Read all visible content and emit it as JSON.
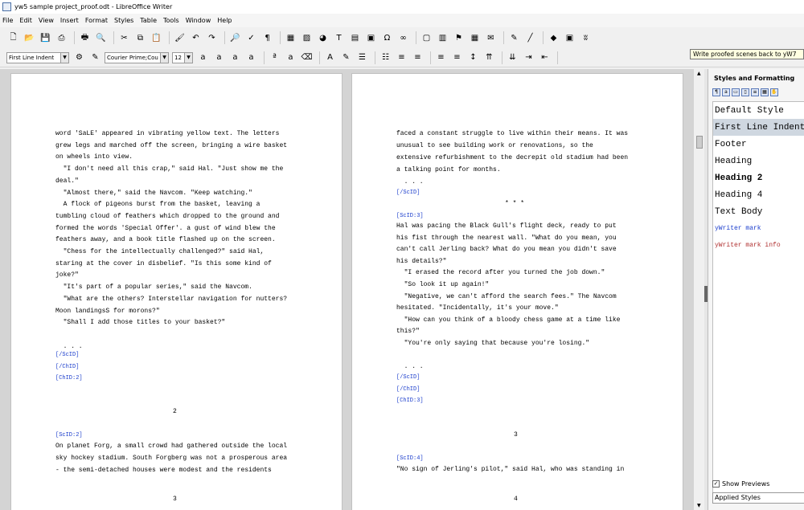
{
  "window": {
    "title": "yw5 sample project_proof.odt - LibreOffice Writer"
  },
  "menu": [
    "File",
    "Edit",
    "View",
    "Insert",
    "Format",
    "Styles",
    "Table",
    "Tools",
    "Window",
    "Help"
  ],
  "formatting": {
    "paragraph_style": "First Line Indent",
    "font_name": "Courier Prime;Cou",
    "font_size": "12"
  },
  "tooltip": "Write proofed scenes back to yW7",
  "toolbar1_icons": [
    "new-document-icon",
    "open-icon",
    "save-icon",
    "export-pdf-icon",
    "print-icon",
    "print-preview-icon",
    "cut-icon",
    "copy-icon",
    "paste-icon",
    "clone-formatting-icon",
    "undo-icon",
    "redo-icon",
    "find-replace-icon",
    "spelling-icon",
    "formatting-marks-icon",
    "insert-table-icon",
    "insert-image-icon",
    "insert-chart-icon",
    "insert-textbox-icon",
    "page-break-icon",
    "insert-field-icon",
    "special-character-icon",
    "hyperlink-icon",
    "footnote-icon",
    "endnote-icon",
    "bookmark-icon",
    "cross-reference-icon",
    "comment-icon",
    "track-changes-icon",
    "line-icon",
    "basic-shapes-icon",
    "draw-functions-icon",
    "yw-proof-icon"
  ],
  "toolbar2_icons": [
    "update-style-icon",
    "new-style-icon",
    "bold-icon",
    "italic-icon",
    "underline-icon",
    "strikethrough-icon",
    "superscript-icon",
    "subscript-icon",
    "clear-formatting-icon",
    "font-color-icon",
    "highlight-icon",
    "bullets-icon",
    "numbering-icon",
    "align-left-icon",
    "align-center-icon",
    "align-right-icon",
    "justify-icon",
    "line-spacing-icon",
    "increase-paragraph-spacing-icon",
    "decrease-paragraph-spacing-icon",
    "increase-indent-icon",
    "decrease-indent-icon"
  ],
  "page_left": {
    "lines": [
      "word 'SaLE' appeared in vibrating yellow text. The letters",
      "grew legs and marched off the screen, bringing a wire basket",
      "on wheels into view.",
      "  \"I don't need all this crap,\" said Hal. \"Just show me the",
      "deal.\"",
      "  \"Almost there,\" said the Navcom. \"Keep watching.\"",
      "  A flock of pigeons burst from the basket, leaving a",
      "tumbling cloud of feathers which dropped to the ground and",
      "formed the words 'Special Offer'. a gust of wind blew the",
      "feathers away, and a book title flashed up on the screen.",
      "  \"Chess for the intellectually challenged?\" said Hal,",
      "staring at the cover in disbelief. \"Is this some kind of",
      "joke?\"",
      "  \"It's part of a popular series,\" said the Navcom.",
      "  \"What are the others? Interstellar navigation for nutters?",
      "Moon landingsS for morons?\"",
      "  \"Shall I add those titles to your basket?\"",
      "",
      "  . . ."
    ],
    "marks": [
      "[/ScID]",
      "[/ChID]",
      "[ChID:2]"
    ],
    "page_number": "2",
    "scene_mark": "[ScID:2]",
    "lines2": [
      "On planet Forg, a small crowd had gathered outside the local",
      "sky hockey stadium. South Forgberg was not a prosperous area",
      "- the semi-detached houses were modest and the residents"
    ],
    "page_number_bottom": "3"
  },
  "page_right": {
    "lines": [
      "faced a constant struggle to live within their means. It was",
      "unusual to see building work or renovations, so the",
      "extensive refurbishment to the decrepit old stadium had been",
      "a talking point for months.",
      "  . . ."
    ],
    "mark1": "[/ScID]",
    "separator": "* * *",
    "mark2": "[ScID:3]",
    "lines2": [
      "Hal was pacing the Black Gull's flight deck, ready to put",
      "his fist through the nearest wall. \"What do you mean, you",
      "can't call Jerling back? What do you mean you didn't save",
      "his details?\"",
      "  \"I erased the record after you turned the job down.\"",
      "  \"So look it up again!\"",
      "  \"Negative, we can't afford the search fees.\" The Navcom",
      "hesitated. \"Incidentally, it's your move.\"",
      "  \"How can you think of a bloody chess game at a time like",
      "this?\"",
      "  \"You're only saying that because you're losing.\"",
      "",
      "  . . ."
    ],
    "marks": [
      "[/ScID]",
      "[/ChID]",
      "[ChID:3]"
    ],
    "page_number": "3",
    "scene_mark": "[ScID:4]",
    "lines3": [
      "\"No sign of Jerling's pilot,\" said Hal, who was standing in"
    ],
    "page_number_bottom": "4"
  },
  "sidebar": {
    "title": "Styles and Formatting",
    "styles": [
      "Default Style",
      "First Line Indent",
      "Footer",
      "Heading",
      "Heading 2",
      "Heading 4",
      "Text Body",
      "yWriter mark",
      "yWriter mark info"
    ],
    "selected": "First Line Indent",
    "show_previews": "Show Previews",
    "filter": "Applied Styles"
  }
}
